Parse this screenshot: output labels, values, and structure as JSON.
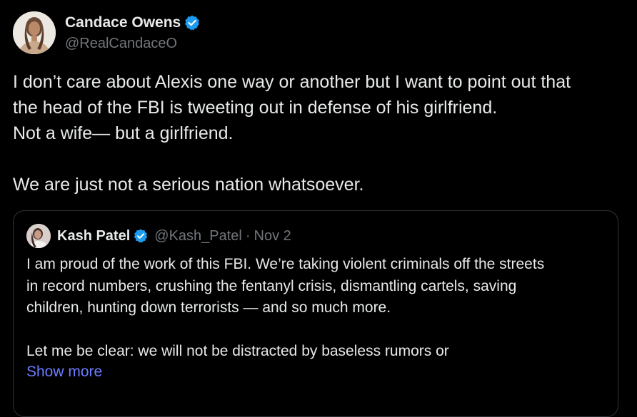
{
  "tweet": {
    "author": {
      "display_name": "Candace Owens",
      "handle": "@RealCandaceO",
      "verified_icon": "verified-badge-icon",
      "avatar_icon": "avatar"
    },
    "text_lines": [
      "I don’t care about Alexis one way or another but I want to point out that",
      "the head of the FBI is tweeting out in defense of his girlfriend.",
      "Not a wife— but a girlfriend.",
      "",
      "We are just not a serious nation whatsoever."
    ],
    "quoted": {
      "display_name": "Kash Patel",
      "handle": "@Kash_Patel",
      "separator": "·",
      "date": "Nov 2",
      "text_lines": [
        "I am proud of the work of this FBI. We’re taking violent criminals off the streets",
        "in record numbers, crushing the fentanyl crisis, dismantling cartels, saving",
        "children, hunting down terrorists — and so much more.",
        "",
        "Let me be clear: we will not be distracted by baseless rumors or"
      ],
      "show_more_label": "Show more"
    }
  },
  "colors": {
    "background": "#000000",
    "primary_text": "#e7e9ea",
    "secondary_text": "#71767b",
    "verified_blue": "#1d9bf0",
    "link": "#6d7cff",
    "border": "#2f3336"
  }
}
